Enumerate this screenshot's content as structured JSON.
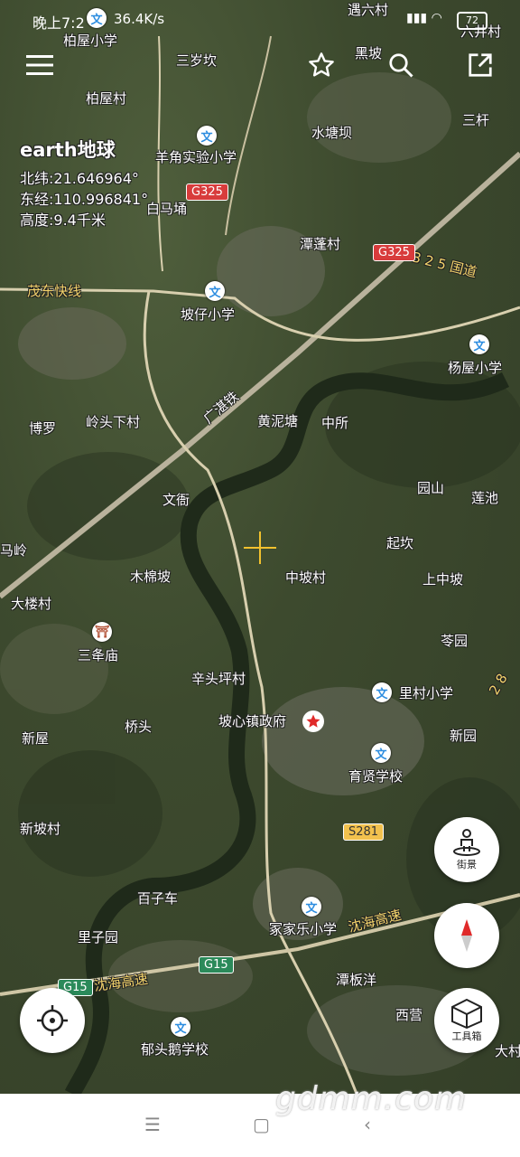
{
  "status": {
    "time": "晚上7:2",
    "net": "36.4K/s",
    "battery": "72"
  },
  "info": {
    "title": "earth地球",
    "lat": "北纬:21.646964°",
    "lon": "东经:110.996841°",
    "alt": "高度:9.4千米"
  },
  "labels": {
    "l1": "柏屋小学",
    "l2": "三岁坎",
    "l3": "遇六村",
    "l4": "六井村",
    "l5": "柏屋村",
    "l6": "黑坡",
    "l7": "羊角实验小学",
    "l8": "水塘坝",
    "l9": "三杆",
    "l10": "白马埇",
    "l11": "潭蓬村",
    "l12": "茂东快线",
    "l13": "坡仔小学",
    "l14": "杨屋小学",
    "l15": "黄泥塘",
    "l16": "中所",
    "l17": "博罗",
    "l18": "岭头下村",
    "l19": "文衙",
    "l20": "园山",
    "l21": "莲池",
    "l22": "起坎",
    "l23": "木棉坡",
    "l24": "中坡村",
    "l25": "上中坡",
    "l26": "大楼村",
    "l27": "三夅庙",
    "l28": "苓园",
    "l29": "辛头坪村",
    "l30": "里村小学",
    "l31": "新屋",
    "l32": "桥头",
    "l33": "坡心镇政府",
    "l34": "新园",
    "l35": "育贤学校",
    "l36": "新坡村",
    "l37": "百子车",
    "l38": "冢家乐小学",
    "l39": "沈海高速",
    "l40": "里子园",
    "l41": "沈海高速",
    "l42": "潭板洋",
    "l43": "西营",
    "l44": "郁头鹅学校",
    "l45": "大村",
    "l46": "广湛铁",
    "l47": "3 2 5 国道",
    "l48": "马岭",
    "l49": "2 8"
  },
  "shields": {
    "g325a": "G325",
    "g325b": "G325",
    "s281": "S281",
    "g15a": "G15",
    "g15b": "G15"
  },
  "poi_glyph": "文",
  "temple_glyph": "⛩",
  "buttons": {
    "street": "街景",
    "tools": "工具箱"
  },
  "watermark": "gdmm.com"
}
